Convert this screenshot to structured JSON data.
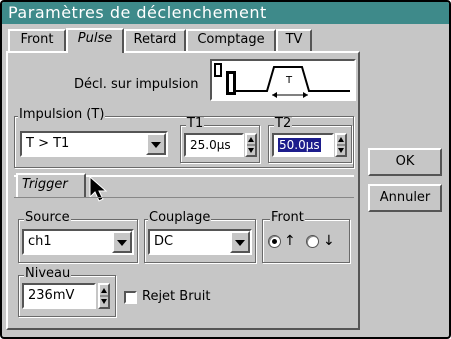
{
  "window": {
    "title": "Paramètres de déclenchement"
  },
  "tabs": [
    "Front",
    "Pulse",
    "Retard",
    "Comptage",
    "TV"
  ],
  "active_tab": "Pulse",
  "pulse": {
    "decl_label": "Décl. sur impulsion",
    "impulsion_label": "Impulsion (T)",
    "condition_value": "T > T1",
    "t1_label": "T1",
    "t1_value": "25.0µs",
    "t2_label": "T2",
    "t2_value": "50.0µs",
    "diagram_label": "T"
  },
  "trigger": {
    "tab_label": "Trigger",
    "source_label": "Source",
    "source_value": "ch1",
    "couplage_label": "Couplage",
    "couplage_value": "DC",
    "front_label": "Front",
    "front_rising_symbol": "↑",
    "front_falling_symbol": "↓",
    "front_selected": "rising",
    "niveau_label": "Niveau",
    "niveau_value": "236mV",
    "rejet_label": "Rejet Bruit",
    "rejet_checked": false
  },
  "buttons": {
    "ok": "OK",
    "annuler": "Annuler"
  }
}
